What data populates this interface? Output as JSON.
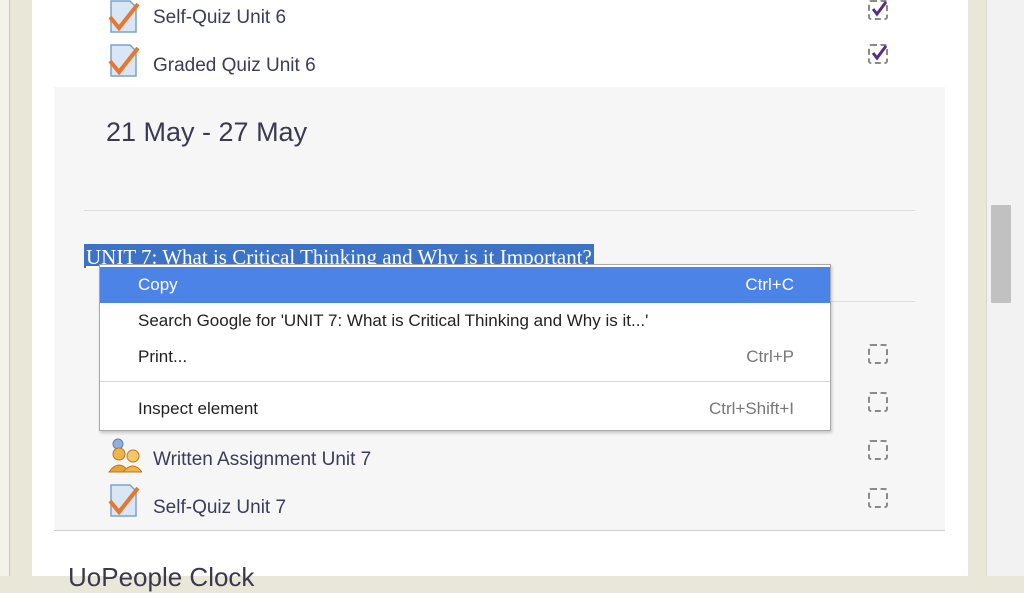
{
  "previous_week": {
    "activities": [
      {
        "label": "Self-Quiz Unit 6",
        "icon": "quiz-icon",
        "completed": true
      },
      {
        "label": "Graded Quiz Unit 6",
        "icon": "quiz-icon",
        "completed": true
      }
    ]
  },
  "week": {
    "title": "21 May - 27 May",
    "unit_heading": "UNIT 7: What is Critical Thinking and Why is it Important?",
    "activities": [
      {
        "label": "Written Assignment Unit 7",
        "icon": "assignment-icon",
        "completed": false
      },
      {
        "label": "Self-Quiz Unit 7",
        "icon": "quiz-icon",
        "completed": false
      }
    ]
  },
  "context_menu": {
    "items": [
      {
        "label": "Copy",
        "shortcut": "Ctrl+C"
      },
      {
        "label": "Search Google for 'UNIT 7: What is Critical Thinking and Why is it...'",
        "shortcut": ""
      },
      {
        "label": "Print...",
        "shortcut": "Ctrl+P"
      },
      {
        "label": "Inspect element",
        "shortcut": "Ctrl+Shift+I"
      }
    ]
  },
  "next_block": {
    "title": "UoPeople Clock"
  },
  "colors": {
    "selection": "#3d73c7",
    "menu_highlight": "#4c83e6",
    "check_purple": "#5a2d82",
    "quiz_orange": "#e8772e"
  }
}
